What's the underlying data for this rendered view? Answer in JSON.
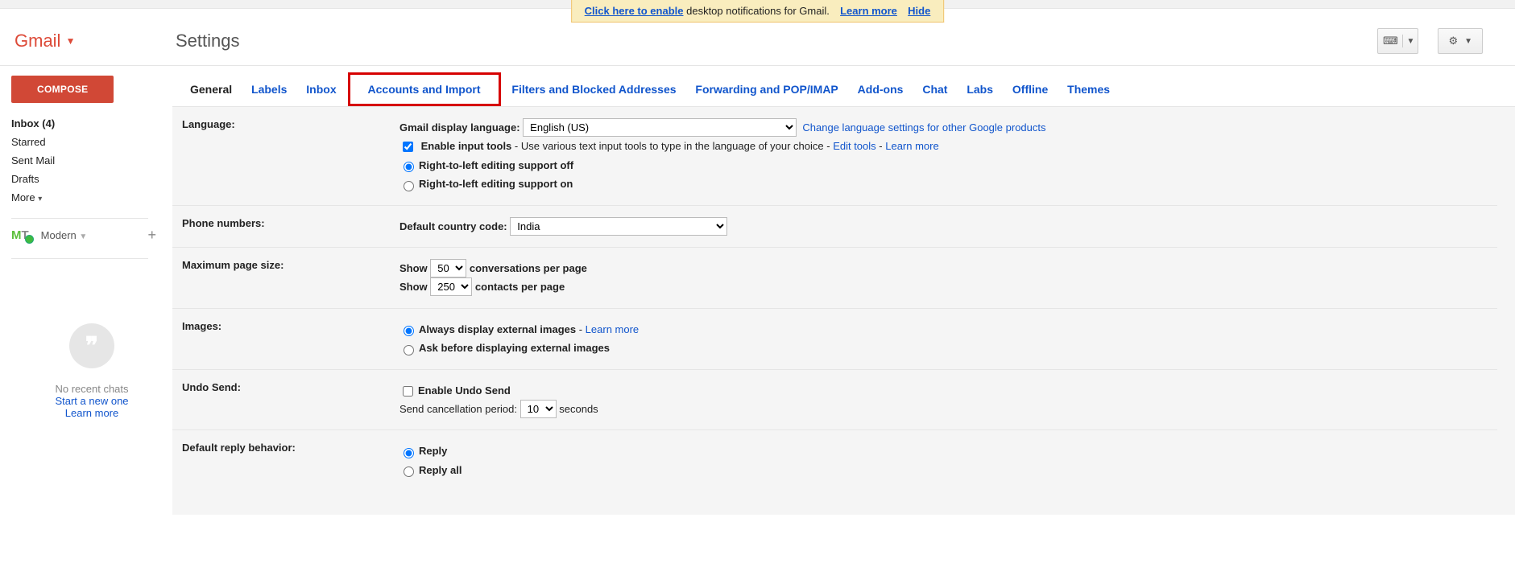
{
  "notify": {
    "enable_link": "Click here to enable",
    "rest": "desktop notifications for Gmail.",
    "learn": "Learn more",
    "hide": "Hide"
  },
  "brand": "Gmail",
  "page_title": "Settings",
  "compose": "COMPOSE",
  "sidebar": {
    "inbox": "Inbox (4)",
    "starred": "Starred",
    "sent": "Sent Mail",
    "drafts": "Drafts",
    "more": "More",
    "label_name": "Modern",
    "hangout_line1": "No recent chats",
    "hangout_line2": "Start a new one",
    "hangout_learn": "Learn more"
  },
  "tabs": {
    "general": "General",
    "labels": "Labels",
    "inbox": "Inbox",
    "accounts": "Accounts and Import",
    "filters": "Filters and Blocked Addresses",
    "forwarding": "Forwarding and POP/IMAP",
    "addons": "Add-ons",
    "chat": "Chat",
    "labs": "Labs",
    "offline": "Offline",
    "themes": "Themes"
  },
  "settings": {
    "language": {
      "label": "Language:",
      "display_label": "Gmail display language:",
      "display_value": "English (US)",
      "change_link": "Change language settings for other Google products",
      "input_tools_b": "Enable input tools",
      "input_tools_rest": " - Use various text input tools to type in the language of your choice - ",
      "edit_tools": "Edit tools",
      "dash": " - ",
      "learn_more": "Learn more",
      "rtl_off": "Right-to-left editing support off",
      "rtl_on": "Right-to-left editing support on"
    },
    "phone": {
      "label": "Phone numbers:",
      "default_label": "Default country code:",
      "value": "India"
    },
    "pagesize": {
      "label": "Maximum page size:",
      "show": "Show",
      "conv_n": "50",
      "conv_txt": "conversations per page",
      "cont_n": "250",
      "cont_txt": "contacts per page"
    },
    "images": {
      "label": "Images:",
      "always": "Always display external images",
      "dash": " - ",
      "learn": "Learn more",
      "ask": "Ask before displaying external images"
    },
    "undo": {
      "label": "Undo Send:",
      "enable": "Enable Undo Send",
      "period_lab": "Send cancellation period:",
      "period_val": "10",
      "seconds": "seconds"
    },
    "reply": {
      "label": "Default reply behavior:",
      "reply": "Reply",
      "all": "Reply all"
    }
  }
}
